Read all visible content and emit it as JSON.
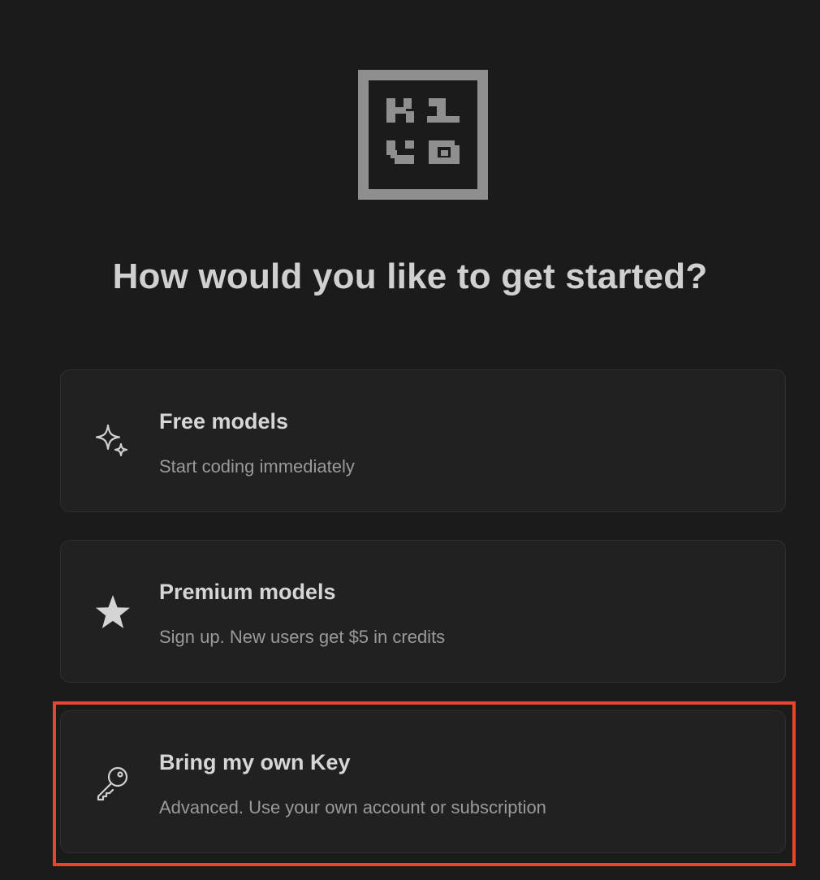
{
  "logo": {
    "icon": "kilo-logo-icon"
  },
  "heading": "How would you like to get started?",
  "options": [
    {
      "icon": "sparkles-icon",
      "title": "Free models",
      "subtitle": "Start coding immediately"
    },
    {
      "icon": "star-icon",
      "title": "Premium models",
      "subtitle": "Sign up. New users get $5 in credits"
    },
    {
      "icon": "key-icon",
      "title": "Bring my own Key",
      "subtitle": "Advanced. Use your own account or subscription"
    }
  ],
  "colors": {
    "background": "#1b1b1b",
    "card": "#212121",
    "highlight_border": "#e8452c"
  }
}
